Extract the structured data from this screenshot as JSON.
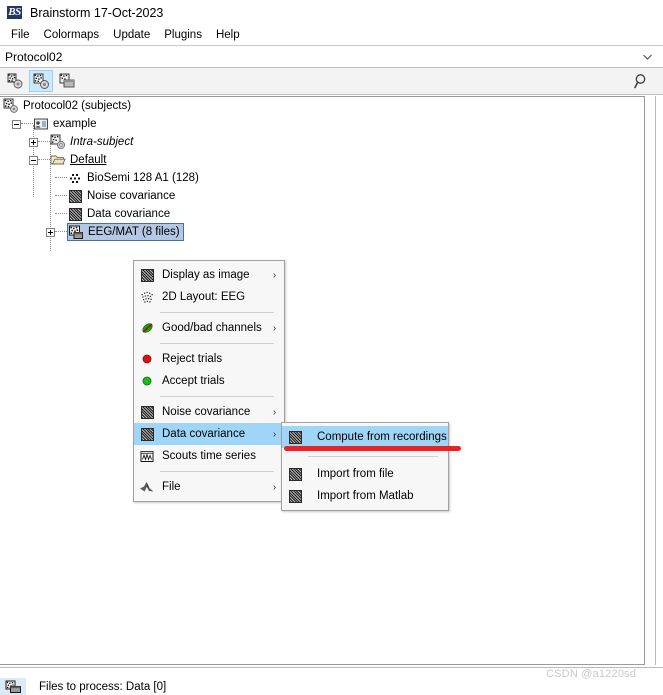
{
  "window": {
    "title": "Brainstorm 17-Oct-2023",
    "logo_icon": "brainstorm-bs-logo",
    "logo_text": "BS"
  },
  "menubar": {
    "items": [
      {
        "label": "File"
      },
      {
        "label": "Colormaps"
      },
      {
        "label": "Update"
      },
      {
        "label": "Plugins"
      },
      {
        "label": "Help"
      }
    ]
  },
  "protocol_bar": {
    "selected": "Protocol02",
    "chevron_icon": "chevron-down-icon"
  },
  "toolbar": {
    "buttons": [
      {
        "name": "anatomy-view-button",
        "icon": "anatomy-icon",
        "selected": false
      },
      {
        "name": "functional-data-view-button",
        "icon": "functional-data-icon",
        "selected": true
      },
      {
        "name": "functional-data-sources-button",
        "icon": "functional-sources-icon",
        "selected": false
      }
    ],
    "search_icon": "search-magnifier-icon"
  },
  "tree": {
    "rows": [
      {
        "indent": 0,
        "toggle": "none",
        "icon": "protocol-icon",
        "label": "Protocol02 (subjects)",
        "style": "normal",
        "selected": false
      },
      {
        "indent": 1,
        "toggle": "minus",
        "icon": "subject-icon",
        "label": "example",
        "style": "normal",
        "selected": false
      },
      {
        "indent": 2,
        "toggle": "plus",
        "icon": "intra-subject-icon",
        "label": "Intra-subject",
        "style": "italic",
        "selected": false
      },
      {
        "indent": 2,
        "toggle": "minus",
        "icon": "folder-icon",
        "label": "Default",
        "style": "underline",
        "selected": false
      },
      {
        "indent": 3,
        "toggle": "none",
        "icon": "channel-icon",
        "label": "BioSemi 128 A1 (128)",
        "style": "normal",
        "selected": false
      },
      {
        "indent": 3,
        "toggle": "none",
        "icon": "covariance-icon",
        "label": "Noise covariance",
        "style": "normal",
        "selected": false
      },
      {
        "indent": 3,
        "toggle": "none",
        "icon": "covariance-icon",
        "label": "Data covariance",
        "style": "normal",
        "selected": false
      },
      {
        "indent": 3,
        "toggle": "plus",
        "icon": "eeg-mat-icon",
        "label": "EEG/MAT (8 files)",
        "style": "normal",
        "selected": true
      }
    ]
  },
  "context_menu": {
    "items": [
      {
        "type": "item",
        "name": "display-as-image",
        "icon": "covariance-icon",
        "label": "Display as image",
        "arrow": "›",
        "highlight": false
      },
      {
        "type": "item",
        "name": "2d-layout-eeg",
        "icon": "2d-layout-icon",
        "label": "2D Layout: EEG",
        "arrow": "",
        "highlight": false
      },
      {
        "type": "separator"
      },
      {
        "type": "item",
        "name": "good-bad-channels",
        "icon": "good-bad-channel-icon",
        "label": "Good/bad channels",
        "arrow": "›",
        "highlight": false
      },
      {
        "type": "separator"
      },
      {
        "type": "item",
        "name": "reject-trials",
        "icon": "red-dot-icon",
        "label": "Reject trials",
        "arrow": "",
        "highlight": false
      },
      {
        "type": "item",
        "name": "accept-trials",
        "icon": "green-dot-icon",
        "label": "Accept trials",
        "arrow": "",
        "highlight": false
      },
      {
        "type": "separator"
      },
      {
        "type": "item",
        "name": "noise-covariance",
        "icon": "covariance-icon",
        "label": "Noise covariance",
        "arrow": "›",
        "highlight": false
      },
      {
        "type": "item",
        "name": "data-covariance",
        "icon": "covariance-icon",
        "label": "Data covariance",
        "arrow": "›",
        "highlight": true
      },
      {
        "type": "item",
        "name": "scouts-time-series",
        "icon": "scouts-icon",
        "label": "Scouts time series",
        "arrow": "",
        "highlight": false
      },
      {
        "type": "separator"
      },
      {
        "type": "item",
        "name": "file",
        "icon": "matlab-icon",
        "label": "File",
        "arrow": "›",
        "highlight": false
      }
    ]
  },
  "context_submenu": {
    "items": [
      {
        "type": "item",
        "name": "compute-from-recordings",
        "icon": "covariance-icon",
        "label": "Compute from recordings",
        "highlight": true
      },
      {
        "type": "separator"
      },
      {
        "type": "item",
        "name": "import-from-file",
        "icon": "covariance-icon",
        "label": "Import from file",
        "highlight": false
      },
      {
        "type": "item",
        "name": "import-from-matlab",
        "icon": "covariance-icon",
        "label": "Import from Matlab",
        "highlight": false
      }
    ]
  },
  "annotation": {
    "color": "#ed2024"
  },
  "bottom": {
    "files_icon": "files-to-process-icon",
    "files_label": "Files to process: Data [0]"
  },
  "watermark": {
    "text": "CSDN @a1220sd"
  }
}
